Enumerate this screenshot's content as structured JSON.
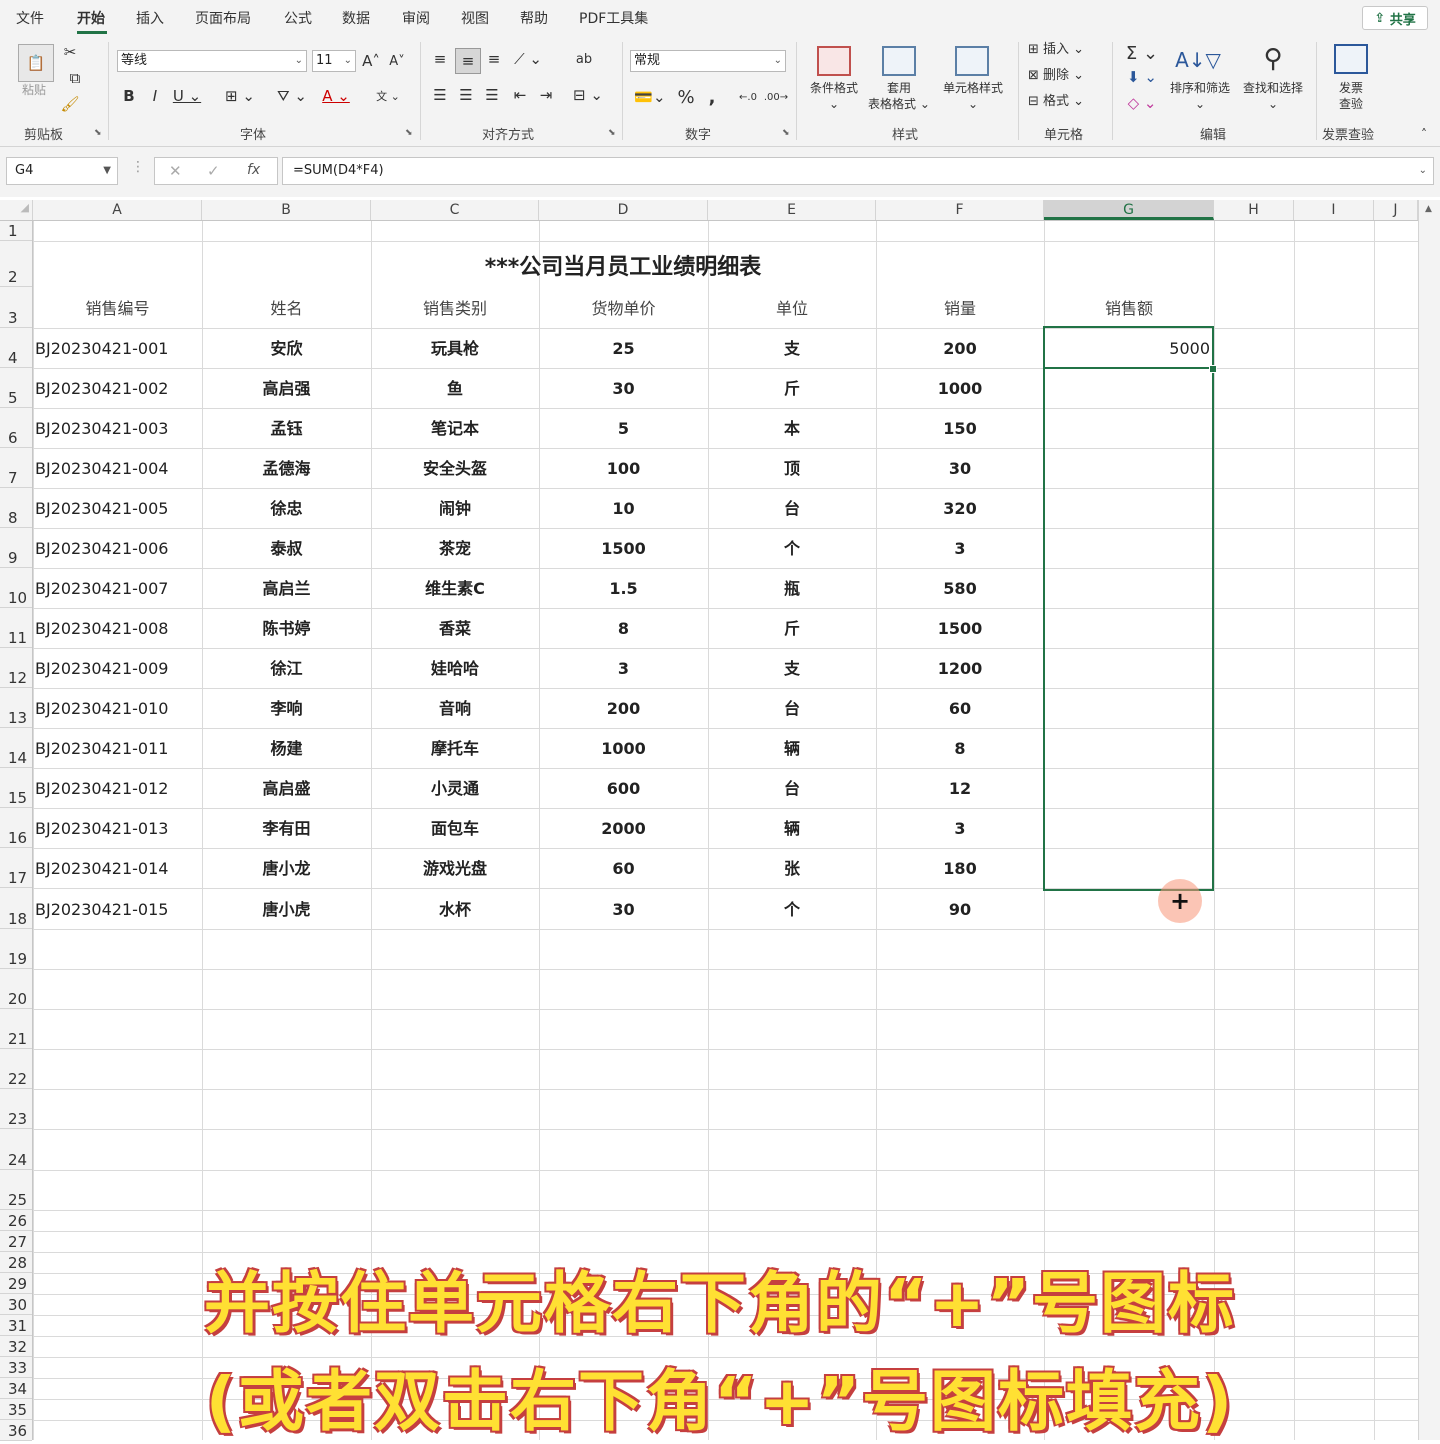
{
  "tabs": [
    "文件",
    "开始",
    "插入",
    "页面布局",
    "公式",
    "数据",
    "审阅",
    "视图",
    "帮助",
    "PDF工具集"
  ],
  "share_label": "共享",
  "ribbon": {
    "paste_label": "粘贴",
    "clipboard_label": "剪贴板",
    "font_name": "等线",
    "font_size": "11",
    "font_group_label": "字体",
    "align_group_label": "对齐方式",
    "number_format": "常规",
    "number_group_label": "数字",
    "cond_format_label": "条件格式",
    "table_format_label_1": "套用",
    "table_format_label_2": "表格格式",
    "cell_style_label": "单元格样式",
    "style_group_label": "样式",
    "insert_label": "插入",
    "delete_label": "删除",
    "format_label": "格式",
    "cells_group_label": "单元格",
    "sort_filter_label": "排序和筛选",
    "find_select_label": "查找和选择",
    "edit_group_label": "编辑",
    "invoice_label_1": "发票",
    "invoice_label_2": "查验",
    "invoice_group_label": "发票查验"
  },
  "formula_bar": {
    "name_box": "G4",
    "formula": "=SUM(D4*F4)"
  },
  "columns": [
    "A",
    "B",
    "C",
    "D",
    "E",
    "F",
    "G",
    "H",
    "I",
    "J"
  ],
  "rows": [
    "1",
    "2",
    "3",
    "4",
    "5",
    "6",
    "7",
    "8",
    "9",
    "10",
    "11",
    "12",
    "13",
    "14",
    "15",
    "16",
    "17",
    "18",
    "19",
    "20",
    "21",
    "22",
    "23",
    "24",
    "25",
    "26",
    "27",
    "28",
    "29",
    "30",
    "31",
    "32",
    "33",
    "34",
    "35",
    "36"
  ],
  "sheet": {
    "title": "***公司当月员工业绩明细表",
    "headers": [
      "销售编号",
      "姓名",
      "销售类别",
      "货物单价",
      "单位",
      "销量",
      "销售额"
    ],
    "records": [
      [
        "BJ20230421-001",
        "安欣",
        "玩具枪",
        "25",
        "支",
        "200",
        "5000"
      ],
      [
        "BJ20230421-002",
        "高启强",
        "鱼",
        "30",
        "斤",
        "1000",
        ""
      ],
      [
        "BJ20230421-003",
        "孟钰",
        "笔记本",
        "5",
        "本",
        "150",
        ""
      ],
      [
        "BJ20230421-004",
        "孟德海",
        "安全头盔",
        "100",
        "顶",
        "30",
        ""
      ],
      [
        "BJ20230421-005",
        "徐忠",
        "闹钟",
        "10",
        "台",
        "320",
        ""
      ],
      [
        "BJ20230421-006",
        "泰叔",
        "茶宠",
        "1500",
        "个",
        "3",
        ""
      ],
      [
        "BJ20230421-007",
        "高启兰",
        "维生素C",
        "1.5",
        "瓶",
        "580",
        ""
      ],
      [
        "BJ20230421-008",
        "陈书婷",
        "香菜",
        "8",
        "斤",
        "1500",
        ""
      ],
      [
        "BJ20230421-009",
        "徐江",
        "娃哈哈",
        "3",
        "支",
        "1200",
        ""
      ],
      [
        "BJ20230421-010",
        "李响",
        "音响",
        "200",
        "台",
        "60",
        ""
      ],
      [
        "BJ20230421-011",
        "杨建",
        "摩托车",
        "1000",
        "辆",
        "8",
        ""
      ],
      [
        "BJ20230421-012",
        "高启盛",
        "小灵通",
        "600",
        "台",
        "12",
        ""
      ],
      [
        "BJ20230421-013",
        "李有田",
        "面包车",
        "2000",
        "辆",
        "3",
        ""
      ],
      [
        "BJ20230421-014",
        "唐小龙",
        "游戏光盘",
        "60",
        "张",
        "180",
        ""
      ],
      [
        "BJ20230421-015",
        "唐小虎",
        "水杯",
        "30",
        "个",
        "90",
        ""
      ]
    ]
  },
  "caption": {
    "line1": "并按住单元格右下角的“+”号图标",
    "line2": "(或者双击右下角“+”号图标填充)"
  }
}
